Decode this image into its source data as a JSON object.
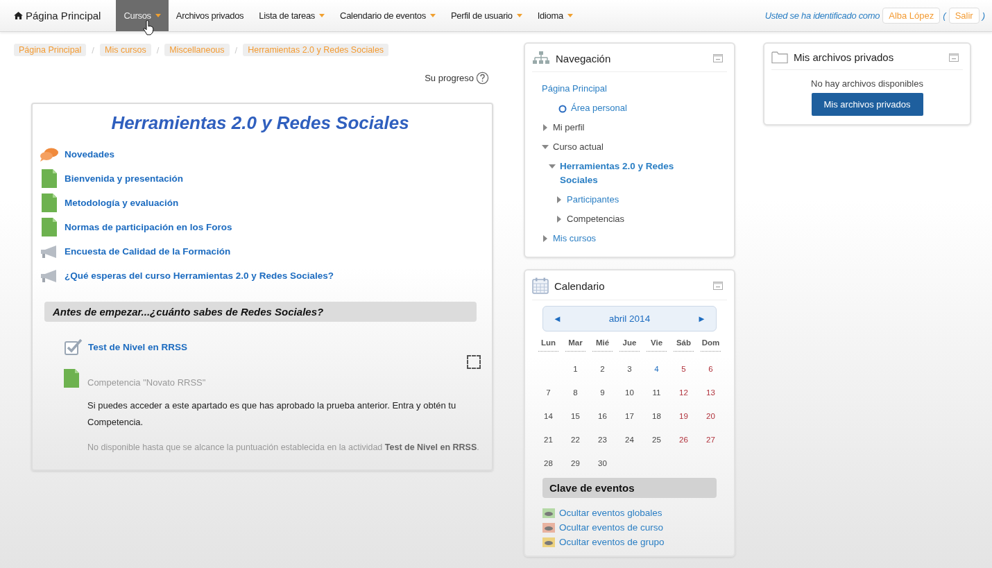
{
  "navbar": {
    "home": "Página Principal",
    "menus": [
      {
        "label": "Cursos",
        "dropdown": true,
        "selected": true
      },
      {
        "label": "Archivos privados",
        "dropdown": false,
        "selected": false
      },
      {
        "label": "Lista de tareas",
        "dropdown": true,
        "selected": false
      },
      {
        "label": "Calendario de eventos",
        "dropdown": true,
        "selected": false
      },
      {
        "label": "Perfil de usuario",
        "dropdown": true,
        "selected": false
      },
      {
        "label": "Idioma",
        "dropdown": true,
        "selected": false
      }
    ],
    "login_text": "Usted se ha identificado como",
    "user": "Alba López",
    "open_paren": "(",
    "logout": "Salir",
    "close_paren": ")"
  },
  "breadcrumb": [
    {
      "label": "Página Principal"
    },
    {
      "separator": "/",
      "label": "Mis cursos"
    },
    {
      "separator": "/",
      "label": "Miscellaneous"
    },
    {
      "separator": "/",
      "label": "Herramientas 2.0 y Redes Sociales"
    }
  ],
  "progress_label": "Su progreso",
  "course": {
    "title": "Herramientas 2.0 y Redes Sociales",
    "items": [
      {
        "kind": "forum",
        "label": "Novedades"
      },
      {
        "kind": "page",
        "label": "Bienvenida y presentación"
      },
      {
        "kind": "page",
        "label": "Metodología y evaluación"
      },
      {
        "kind": "page",
        "label": "Normas de participación en los Foros"
      },
      {
        "kind": "survey",
        "label": "Encuesta de Calidad de la Formación"
      },
      {
        "kind": "survey",
        "label": "¿Qué esperas del curso Herramientas 2.0 y Redes Sociales?"
      }
    ],
    "section": {
      "title": "Antes de empezar...¿cuánto sabes de Redes Sociales?",
      "quiz": "Test de Nivel en RRSS",
      "completion_checked": false,
      "restricted": {
        "title": "Competencia \"Novato RRSS\"",
        "description": "Si puedes acceder a este apartado es que has aprobado la prueba anterior. Entra y obtén tu Competencia.",
        "notice": "No disponible hasta que se alcance la puntuación establecida en la actividad **Test de Nivel en RRSS**."
      }
    }
  },
  "navigation": {
    "title": "Navegación",
    "items": [
      {
        "label": "Página Principal",
        "link": true,
        "bold": false,
        "children": [
          {
            "label": "Área personal",
            "link": true,
            "bold": false,
            "kind": "circle"
          },
          {
            "label": "Mi perfil",
            "link": false,
            "bold": false,
            "kind": "branch",
            "expanded": false
          },
          {
            "label": "Curso actual",
            "link": false,
            "bold": false,
            "kind": "branch",
            "expanded": true,
            "children": [
              {
                "label": "Herramientas 2.0 y Redes Sociales",
                "link": true,
                "bold": true,
                "kind": "branch",
                "expanded": true,
                "children": [
                  {
                    "label": "Participantes",
                    "link": true,
                    "bold": false,
                    "kind": "branch",
                    "expanded": false
                  },
                  {
                    "label": "Competencias",
                    "link": false,
                    "bold": false,
                    "kind": "branch",
                    "expanded": false
                  }
                ]
              }
            ]
          },
          {
            "label": "Mis cursos",
            "link": true,
            "bold": false,
            "kind": "branch",
            "expanded": false
          }
        ]
      }
    ]
  },
  "calendar": {
    "title": "Calendario",
    "prev": "◄",
    "month": "abril 2014",
    "next": "►",
    "weekdays": [
      "Lun",
      "Mar",
      "Mié",
      "Jue",
      "Vie",
      "Sáb",
      "Dom"
    ],
    "weeks": [
      [
        {
          "day": "1",
          "kind": "plain"
        },
        {
          "day": "2",
          "kind": "plain"
        },
        {
          "day": "3",
          "kind": "plain"
        },
        {
          "day": "4",
          "kind": "event"
        },
        {
          "day": "5",
          "kind": "weekend"
        },
        {
          "day": "6",
          "kind": "weekend"
        }
      ],
      [
        {
          "day": "7",
          "kind": "plain"
        },
        {
          "day": "8",
          "kind": "plain"
        },
        {
          "day": "9",
          "kind": "plain"
        },
        {
          "day": "10",
          "kind": "plain"
        },
        {
          "day": "11",
          "kind": "plain"
        },
        {
          "day": "12",
          "kind": "weekend"
        },
        {
          "day": "13",
          "kind": "weekend"
        }
      ],
      [
        {
          "day": "14",
          "kind": "plain"
        },
        {
          "day": "15",
          "kind": "plain"
        },
        {
          "day": "16",
          "kind": "plain"
        },
        {
          "day": "17",
          "kind": "plain"
        },
        {
          "day": "18",
          "kind": "plain"
        },
        {
          "day": "19",
          "kind": "weekend"
        },
        {
          "day": "20",
          "kind": "weekend"
        }
      ],
      [
        {
          "day": "21",
          "kind": "plain"
        },
        {
          "day": "22",
          "kind": "plain"
        },
        {
          "day": "23",
          "kind": "plain"
        },
        {
          "day": "24",
          "kind": "plain"
        },
        {
          "day": "25",
          "kind": "plain"
        },
        {
          "day": "26",
          "kind": "weekend"
        },
        {
          "day": "27",
          "kind": "weekend"
        }
      ],
      [
        {
          "day": "28",
          "kind": "plain"
        },
        {
          "day": "29",
          "kind": "plain"
        },
        {
          "day": "30",
          "kind": "plain"
        }
      ]
    ],
    "key_title": "Clave de eventos",
    "keys": [
      {
        "label": "Ocultar eventos globales",
        "color": "#b5d9a6"
      },
      {
        "label": "Ocultar eventos de curso",
        "color": "#e9b3a0"
      },
      {
        "label": "Ocultar eventos de grupo",
        "color": "#edd27e"
      }
    ]
  },
  "files": {
    "title": "Mis archivos privados",
    "empty": "No hay archivos disponibles",
    "button": "Mis archivos privados"
  }
}
